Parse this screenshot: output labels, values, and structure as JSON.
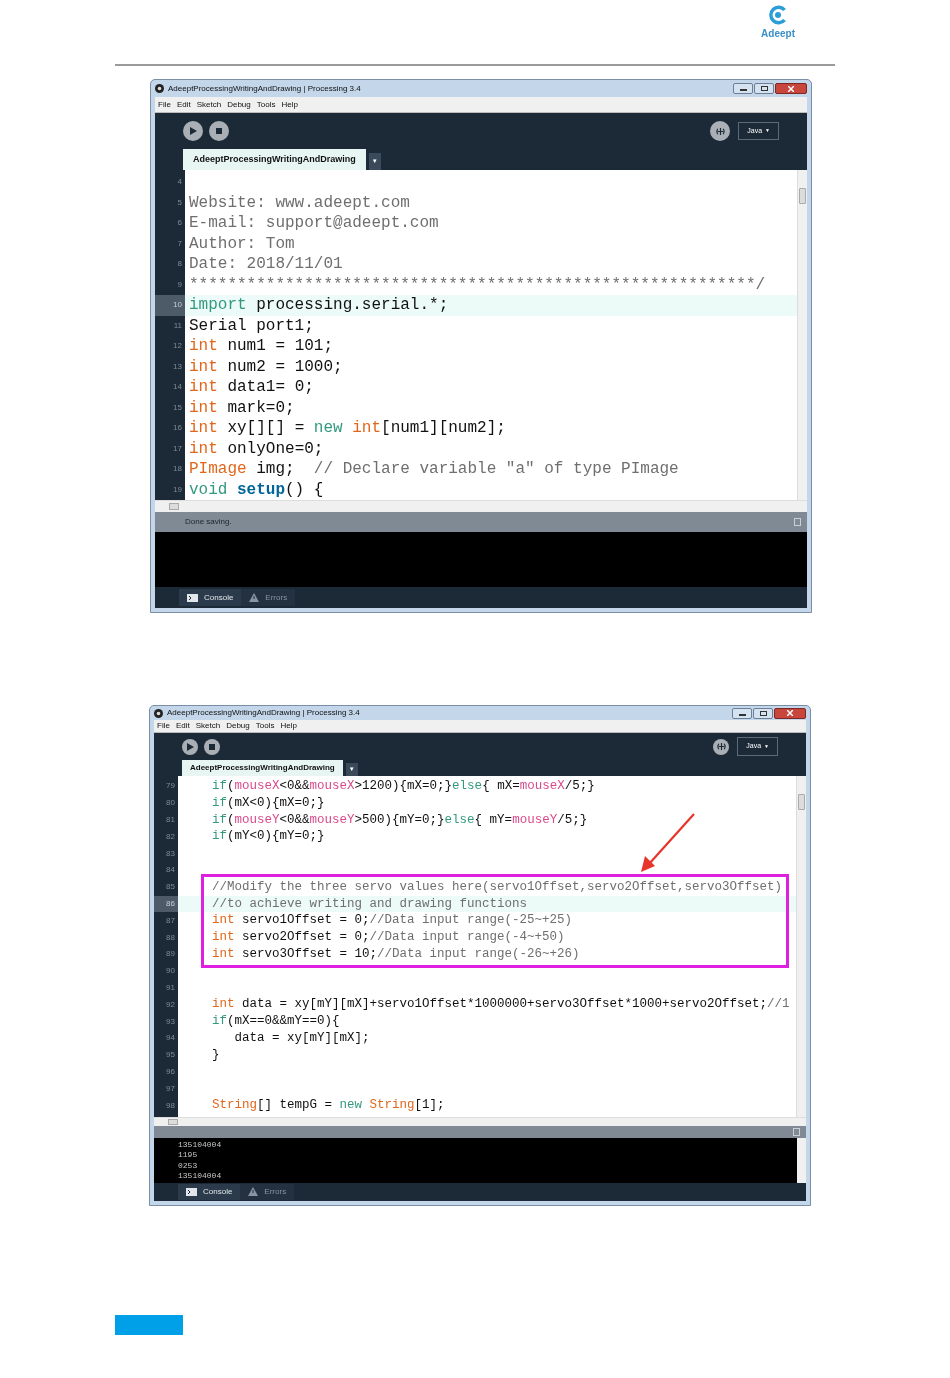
{
  "logo": {
    "text": "Adeept"
  },
  "windows": [
    {
      "title": "AdeeptProcessingWritingAndDrawing | Processing 3.4",
      "menu": [
        "File",
        "Edit",
        "Sketch",
        "Debug",
        "Tools",
        "Help"
      ],
      "mode": "Java",
      "mode_arrow": "▼",
      "tab": "AdeeptProcessingWritingAndDrawing",
      "tab_menu": "▼",
      "lines": [
        {
          "n": "4",
          "current": false
        },
        {
          "n": "5",
          "current": false,
          "tokens": [
            {
              "kind": "comment",
              "text": "Website: www.adeept.com"
            }
          ]
        },
        {
          "n": "6",
          "current": false,
          "tokens": [
            {
              "kind": "comment",
              "text": "E-mail: support@adeept.com"
            }
          ]
        },
        {
          "n": "7",
          "current": false,
          "tokens": [
            {
              "kind": "comment",
              "text": "Author: Tom"
            }
          ]
        },
        {
          "n": "8",
          "current": false,
          "tokens": [
            {
              "kind": "comment",
              "text": "Date: 2018/11/01"
            }
          ]
        },
        {
          "n": "9",
          "current": false,
          "tokens": [
            {
              "kind": "comment",
              "text": "***********************************************************/"
            }
          ]
        },
        {
          "n": "10",
          "current": true,
          "tokens": [
            {
              "kind": "kw",
              "text": "import"
            },
            {
              "kind": "text",
              "text": " processing.serial.*;"
            }
          ]
        },
        {
          "n": "11",
          "current": false,
          "tokens": [
            {
              "kind": "text",
              "text": "Serial port1;"
            }
          ]
        },
        {
          "n": "12",
          "current": false,
          "tokens": [
            {
              "kind": "type",
              "text": "int"
            },
            {
              "kind": "text",
              "text": " num1 = 101;"
            }
          ]
        },
        {
          "n": "13",
          "current": false,
          "tokens": [
            {
              "kind": "type",
              "text": "int"
            },
            {
              "kind": "text",
              "text": " num2 = 1000;"
            }
          ]
        },
        {
          "n": "14",
          "current": false,
          "tokens": [
            {
              "kind": "type",
              "text": "int"
            },
            {
              "kind": "text",
              "text": " data1= 0;"
            }
          ]
        },
        {
          "n": "15",
          "current": false,
          "tokens": [
            {
              "kind": "type",
              "text": "int"
            },
            {
              "kind": "text",
              "text": " mark=0;"
            }
          ]
        },
        {
          "n": "16",
          "current": false,
          "tokens": [
            {
              "kind": "type",
              "text": "int"
            },
            {
              "kind": "text",
              "text": " xy[][] = "
            },
            {
              "kind": "kw",
              "text": "new"
            },
            {
              "kind": "type",
              "text": " int"
            },
            {
              "kind": "text",
              "text": "[num1][num2];"
            }
          ]
        },
        {
          "n": "17",
          "current": false,
          "tokens": [
            {
              "kind": "type",
              "text": "int"
            },
            {
              "kind": "text",
              "text": " onlyOne=0;"
            }
          ]
        },
        {
          "n": "18",
          "current": false,
          "tokens": [
            {
              "kind": "type",
              "text": "PImage"
            },
            {
              "kind": "text",
              "text": " img;  "
            },
            {
              "kind": "comment",
              "text": "// Declare variable \"a\" of type PImage"
            }
          ]
        },
        {
          "n": "19",
          "current": false,
          "tokens": [
            {
              "kind": "kw",
              "text": "void"
            },
            {
              "kind": "fn",
              "text": " setup"
            },
            {
              "kind": "text",
              "text": "() {"
            }
          ]
        }
      ],
      "status": "Done saving.",
      "bottom_tabs": [
        {
          "kind": "console",
          "label": "Console",
          "selected": true
        },
        {
          "kind": "errors",
          "label": "Errors",
          "selected": false
        }
      ]
    },
    {
      "title": "AdeeptProcessingWritingAndDrawing | Processing 3.4",
      "menu": [
        "File",
        "Edit",
        "Sketch",
        "Debug",
        "Tools",
        "Help"
      ],
      "mode": "Java",
      "mode_arrow": "▼",
      "tab": "AdeeptProcessingWritingAndDrawing",
      "tab_menu": "▼",
      "lines": [
        {
          "n": "79",
          "current": false,
          "boxed": false,
          "tokens": [
            {
              "kind": "kw",
              "text": "    if"
            },
            {
              "kind": "text",
              "text": "("
            },
            {
              "kind": "var",
              "text": "mouseX"
            },
            {
              "kind": "text",
              "text": "<0&&"
            },
            {
              "kind": "var",
              "text": "mouseX"
            },
            {
              "kind": "text",
              "text": ">1200){mX=0;}"
            },
            {
              "kind": "kw",
              "text": "else"
            },
            {
              "kind": "text",
              "text": "{ mX="
            },
            {
              "kind": "var",
              "text": "mouseX"
            },
            {
              "kind": "text",
              "text": "/5;}"
            }
          ]
        },
        {
          "n": "80",
          "current": false,
          "boxed": false,
          "tokens": [
            {
              "kind": "kw",
              "text": "    if"
            },
            {
              "kind": "text",
              "text": "(mX<0){mX=0;}"
            }
          ]
        },
        {
          "n": "81",
          "current": false,
          "boxed": false,
          "tokens": [
            {
              "kind": "kw",
              "text": "    if"
            },
            {
              "kind": "text",
              "text": "("
            },
            {
              "kind": "var",
              "text": "mouseY"
            },
            {
              "kind": "text",
              "text": "<0&&"
            },
            {
              "kind": "var",
              "text": "mouseY"
            },
            {
              "kind": "text",
              "text": ">500){mY=0;}"
            },
            {
              "kind": "kw",
              "text": "else"
            },
            {
              "kind": "text",
              "text": "{ mY="
            },
            {
              "kind": "var",
              "text": "mouseY"
            },
            {
              "kind": "text",
              "text": "/5;}"
            }
          ]
        },
        {
          "n": "82",
          "current": false,
          "boxed": false,
          "tokens": [
            {
              "kind": "kw",
              "text": "    if"
            },
            {
              "kind": "text",
              "text": "(mY<0){mY=0;}"
            }
          ]
        },
        {
          "n": "83",
          "current": false,
          "boxed": false
        },
        {
          "n": "84",
          "current": false,
          "boxed": false
        },
        {
          "n": "85",
          "current": false,
          "boxed": true,
          "tokens": [
            {
              "kind": "comment",
              "text": "    //Modify the three servo values here(servo1Offset,servo2Offset,servo3Offset)"
            }
          ]
        },
        {
          "n": "86",
          "current": true,
          "boxed": true,
          "tokens": [
            {
              "kind": "comment",
              "text": "    //to achieve writing and drawing functions"
            }
          ]
        },
        {
          "n": "87",
          "current": false,
          "boxed": true,
          "tokens": [
            {
              "kind": "type",
              "text": "    int"
            },
            {
              "kind": "text",
              "text": " servo1Offset = 0;"
            },
            {
              "kind": "comment",
              "text": "//Data input range(-25~+25)"
            }
          ]
        },
        {
          "n": "88",
          "current": false,
          "boxed": true,
          "tokens": [
            {
              "kind": "type",
              "text": "    int"
            },
            {
              "kind": "text",
              "text": " servo2Offset = 0;"
            },
            {
              "kind": "comment",
              "text": "//Data input range(-4~+50)"
            }
          ]
        },
        {
          "n": "89",
          "current": false,
          "boxed": true,
          "tokens": [
            {
              "kind": "type",
              "text": "    int"
            },
            {
              "kind": "text",
              "text": " servo3Offset = 10;"
            },
            {
              "kind": "comment",
              "text": "//Data input range(-26~+26)"
            }
          ]
        },
        {
          "n": "90",
          "current": false,
          "boxed": false
        },
        {
          "n": "91",
          "current": false,
          "boxed": false
        },
        {
          "n": "92",
          "current": false,
          "boxed": false,
          "tokens": [
            {
              "kind": "type",
              "text": "    int"
            },
            {
              "kind": "text",
              "text": " data = xy[mY][mX]+servo1Offset*1000000+servo3Offset*1000+servo2Offset;"
            },
            {
              "kind": "comment",
              "text": "//1"
            }
          ]
        },
        {
          "n": "93",
          "current": false,
          "boxed": false,
          "tokens": [
            {
              "kind": "kw",
              "text": "    if"
            },
            {
              "kind": "text",
              "text": "(mX==0&&mY==0){"
            }
          ]
        },
        {
          "n": "94",
          "current": false,
          "boxed": false,
          "tokens": [
            {
              "kind": "text",
              "text": "       data = xy[mY][mX];"
            }
          ]
        },
        {
          "n": "95",
          "current": false,
          "boxed": false,
          "tokens": [
            {
              "kind": "text",
              "text": "    }"
            }
          ]
        },
        {
          "n": "96",
          "current": false,
          "boxed": false
        },
        {
          "n": "97",
          "current": false,
          "boxed": false
        },
        {
          "n": "98",
          "current": false,
          "boxed": false,
          "tokens": [
            {
              "kind": "type",
              "text": "    String"
            },
            {
              "kind": "text",
              "text": "[] tempG = "
            },
            {
              "kind": "kw",
              "text": "new"
            },
            {
              "kind": "type",
              "text": " String"
            },
            {
              "kind": "text",
              "text": "[1];"
            }
          ]
        }
      ],
      "console": [
        "135104004",
        "1195",
        "0253",
        "135104004"
      ],
      "bottom_tabs": [
        {
          "kind": "console",
          "label": "Console",
          "selected": true
        },
        {
          "kind": "errors",
          "label": "Errors",
          "selected": false
        }
      ]
    }
  ]
}
